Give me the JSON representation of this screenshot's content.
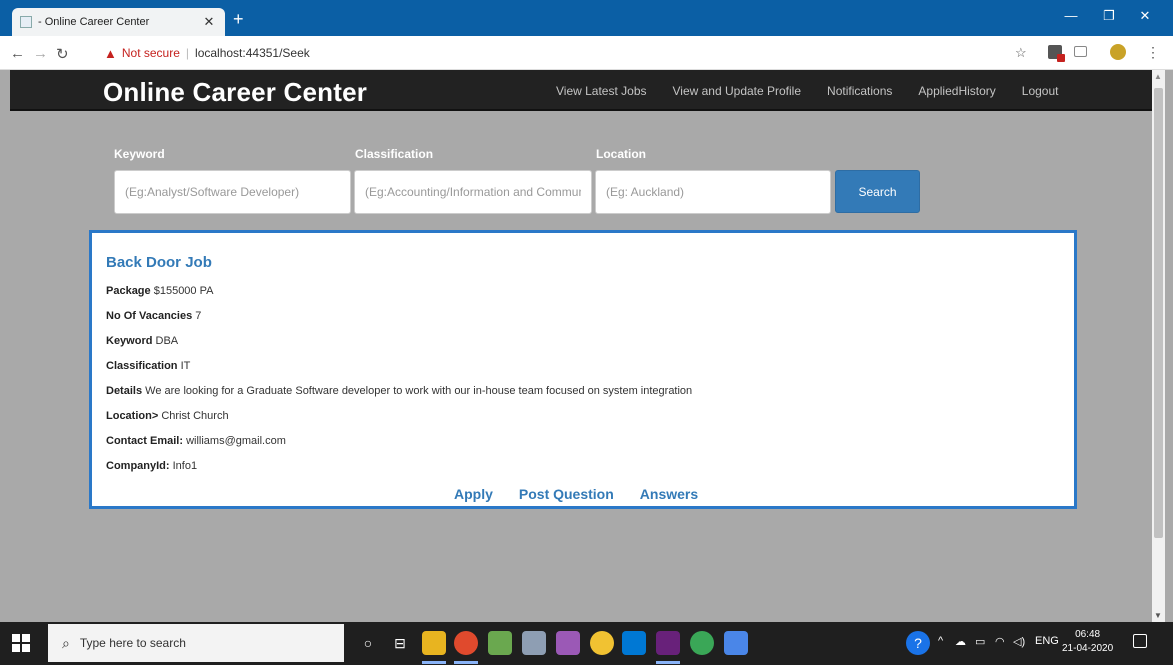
{
  "browser": {
    "tab_title": "- Online Career Center",
    "not_secure": "Not secure",
    "url": "localhost:44351/Seek"
  },
  "site": {
    "brand": "Online Career Center",
    "nav": [
      "View Latest Jobs",
      "View and Update Profile",
      "Notifications",
      "AppliedHistory",
      "Logout"
    ]
  },
  "search": {
    "keyword_label": "Keyword",
    "keyword_placeholder": "(Eg:Analyst/Software Developer)",
    "classification_label": "Classification",
    "classification_placeholder": "(Eg:Accounting/Information and Communication)",
    "location_label": "Location",
    "location_placeholder": "(Eg: Auckland)",
    "button": "Search"
  },
  "job": {
    "title": "Back Door Job",
    "package_label": "Package",
    "package_value": "$155000 PA",
    "vacancies_label": "No Of Vacancies",
    "vacancies_value": "7",
    "keyword_label": "Keyword",
    "keyword_value": "DBA",
    "classification_label": "Classification",
    "classification_value": "IT",
    "details_label": "Details",
    "details_value": "We are looking for a Graduate Software developer to work with our in-house team focused on system integration",
    "location_label": "Location>",
    "location_value": "Christ Church",
    "email_label": "Contact Email:",
    "email_value": "williams@gmail.com",
    "company_label": "CompanyId:",
    "company_value": "Info1",
    "actions": [
      "Apply",
      "Post Question",
      "Answers"
    ]
  },
  "taskbar": {
    "search_placeholder": "Type here to search",
    "language": "ENG",
    "time": "06:48",
    "date": "21-04-2020"
  },
  "colors": {
    "accent": "#337ab7",
    "header_bg": "#222222",
    "page_bg": "#a9a9a9",
    "card_border": "#2a78c8"
  }
}
